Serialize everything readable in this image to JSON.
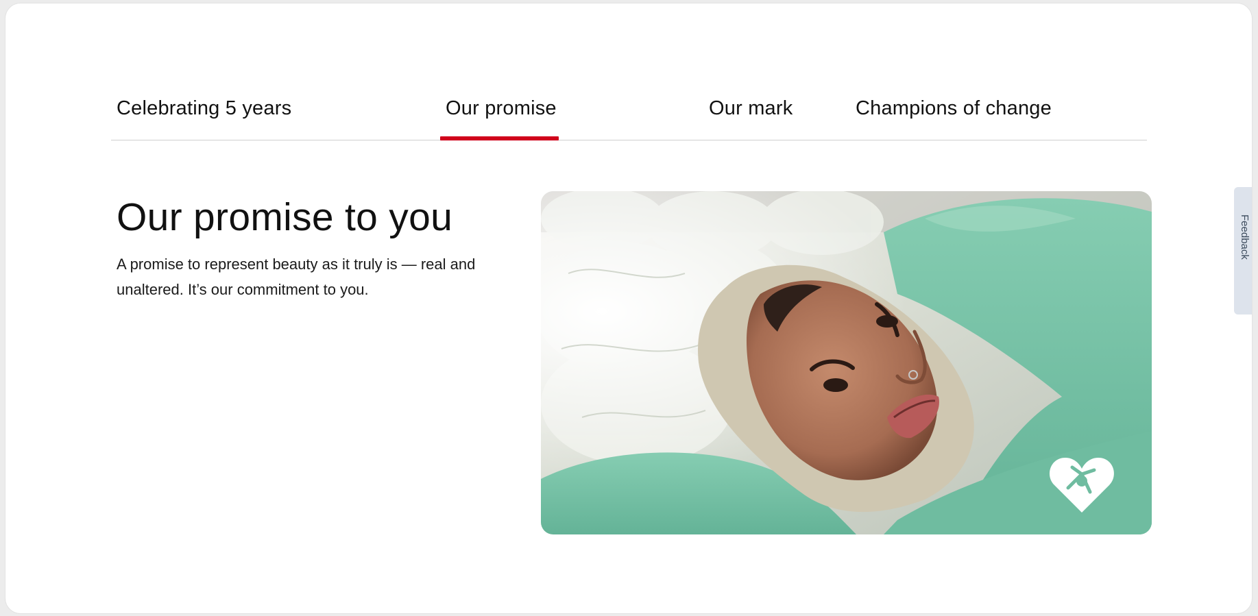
{
  "tabs": [
    {
      "label": "Celebrating 5 years",
      "active": false
    },
    {
      "label": "Our promise",
      "active": true
    },
    {
      "label": "Our mark",
      "active": false
    },
    {
      "label": "Champions of change",
      "active": false
    }
  ],
  "section": {
    "headline": "Our promise to you",
    "body": "A promise to represent beauty as it truly is — real and unaltered. It’s our commitment to you."
  },
  "hero_image": {
    "subject": "woman-resting-on-pillow",
    "badge_icon": "heart-shutter-mark-icon"
  },
  "feedback": {
    "label": "Feedback"
  },
  "colors": {
    "accent": "#d0021b",
    "tab_rule": "#cfcfcf",
    "feedback_bg": "#dde3ec"
  }
}
